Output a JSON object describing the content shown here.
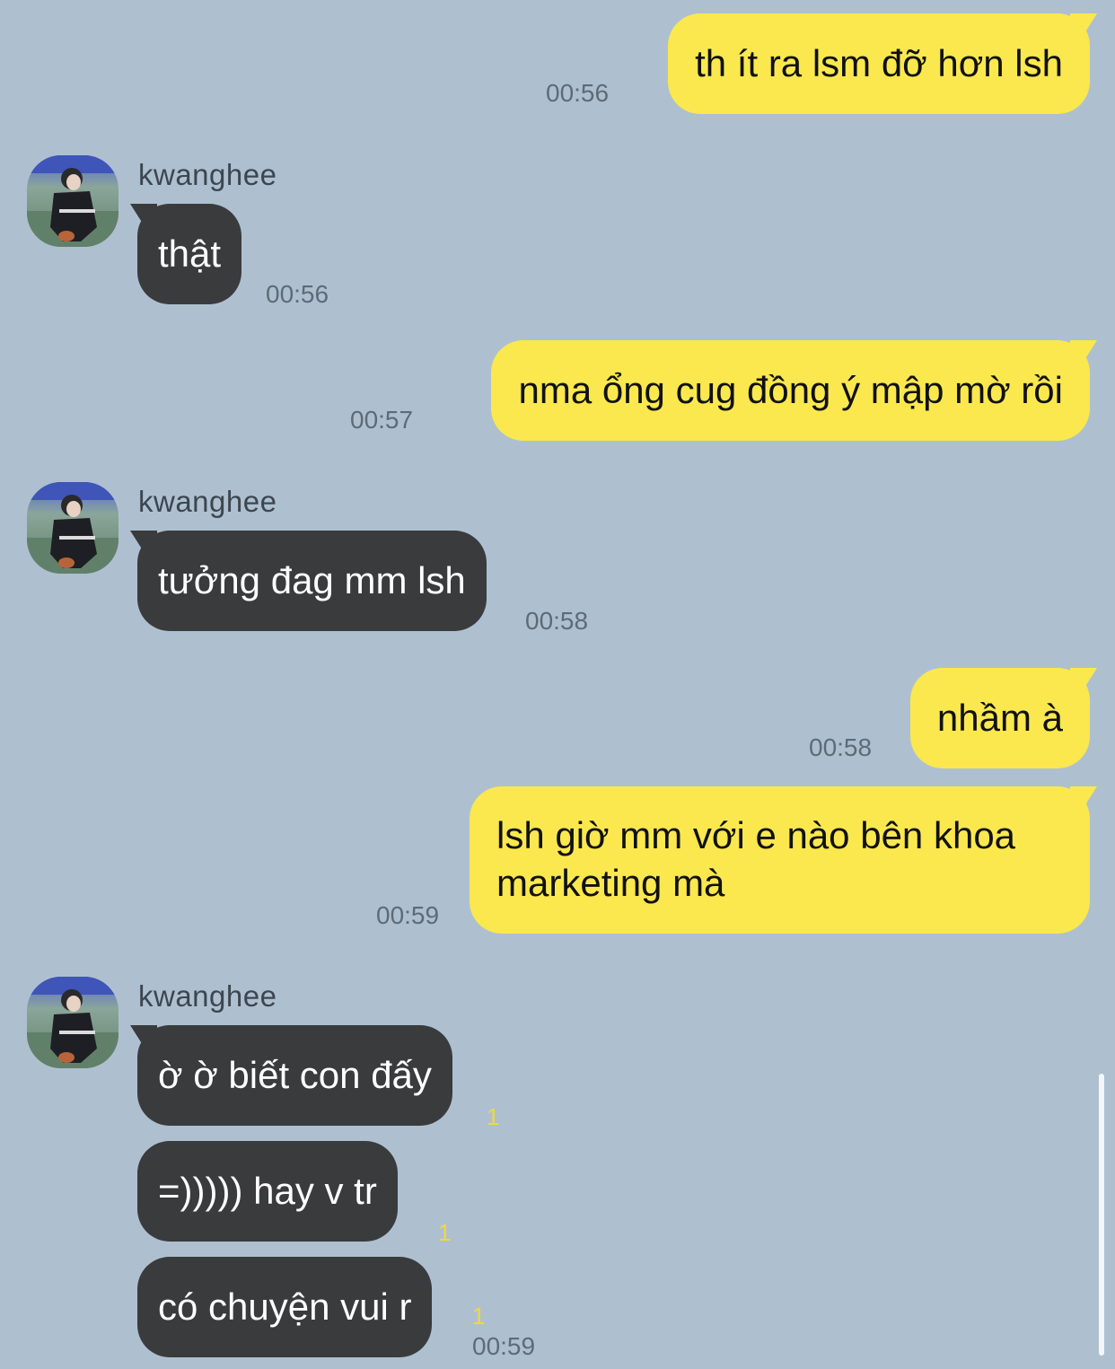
{
  "contact": {
    "name": "kwanghee",
    "avatar_icon": "profile-photo-icon"
  },
  "colors": {
    "background": "#aec0d0",
    "outgoing_bubble": "#fae84e",
    "incoming_bubble": "#3a3b3d",
    "unread": "#f0d93a"
  },
  "messages": [
    {
      "dir": "out",
      "text": "th ít ra lsm đỡ hơn lsh",
      "time": "00:56"
    },
    {
      "dir": "in",
      "sender": "kwanghee",
      "text": "thật",
      "time": "00:56"
    },
    {
      "dir": "out",
      "text": "nma ổng cug đồng ý mập mờ rồi",
      "time": "00:57"
    },
    {
      "dir": "in",
      "sender": "kwanghee",
      "text": "tưởng đag mm lsh",
      "time": "00:58"
    },
    {
      "dir": "out",
      "text": "nhầm à",
      "time": "00:58"
    },
    {
      "dir": "out",
      "lines": [
        "lsh giờ mm với e nào bên khoa",
        "marketing mà"
      ],
      "time": "00:59"
    },
    {
      "dir": "in",
      "sender": "kwanghee",
      "text": "ờ ờ biết con đấy",
      "unread": "1"
    },
    {
      "dir": "in",
      "text": "=))))) hay v tr",
      "unread": "1"
    },
    {
      "dir": "in",
      "text": "có chuyện vui r",
      "unread": "1",
      "time": "00:59"
    }
  ]
}
